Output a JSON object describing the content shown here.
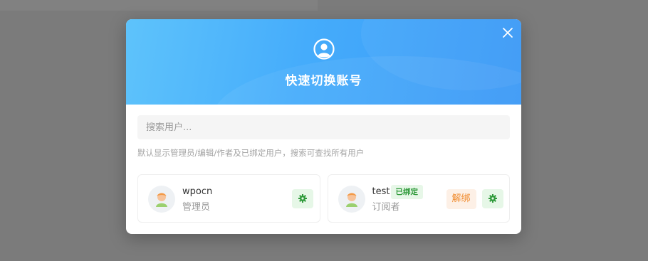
{
  "modal": {
    "title": "快速切换账号",
    "header_icon": "user-circle-icon",
    "close_icon": "close-icon"
  },
  "search": {
    "placeholder": "搜索用户...",
    "value": ""
  },
  "hint": "默认显示管理员/编辑/作者及已绑定用户，搜索可查找所有用户",
  "users": [
    {
      "name": "wpocn",
      "role": "管理员",
      "avatar": "user-avatar-icon",
      "bound": false,
      "actions": {
        "settings_icon": "gear-icon"
      }
    },
    {
      "name": "test",
      "role": "订阅者",
      "avatar": "user-avatar-icon",
      "bound": true,
      "badge": "已绑定",
      "actions": {
        "unbind_label": "解绑",
        "settings_icon": "gear-icon"
      }
    }
  ],
  "colors": {
    "header_gradient_start": "#5ec3fb",
    "header_gradient_end": "#3a98f6",
    "success_green": "#2f9a3a",
    "warning_orange": "#f08a2c"
  }
}
